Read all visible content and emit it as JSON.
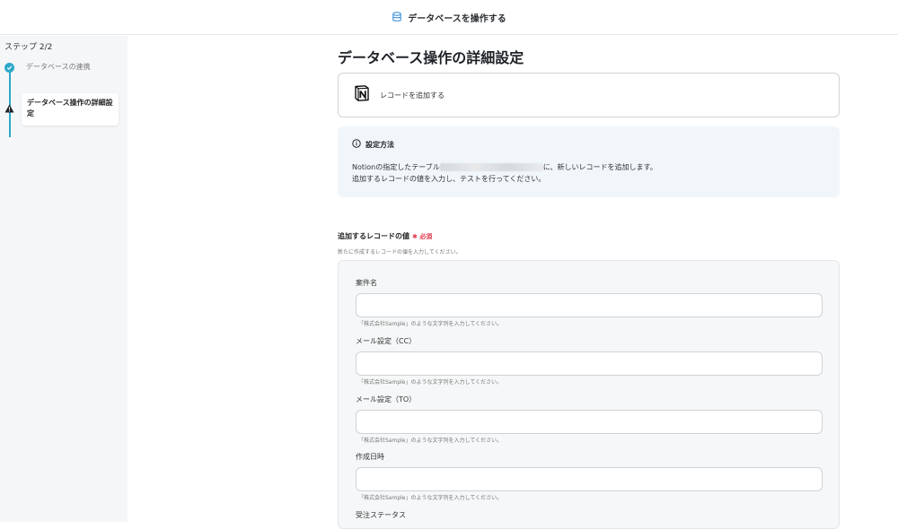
{
  "header": {
    "title": "データベースを操作する",
    "icon": "database-icon"
  },
  "sidebar": {
    "step_counter": "ステップ 2/2",
    "steps": [
      {
        "label": "データベースの連携",
        "status": "completed"
      },
      {
        "label": "データベース操作の詳細設定",
        "status": "current"
      }
    ]
  },
  "main": {
    "title": "データベース操作の詳細設定",
    "app_card": {
      "icon": "notion-logo-icon",
      "label": "レコードを追加する"
    },
    "info": {
      "heading": "設定方法",
      "line1_prefix": "Notionの指定したテーブル",
      "line1_suffix": "に、新しいレコードを追加します。",
      "line2": "追加するレコードの値を入力し、テストを行ってください。"
    },
    "record_section": {
      "heading": "追加するレコードの値",
      "required": "必須",
      "description": "新たに作成するレコードの値を入力してください。",
      "fields": [
        {
          "label": "案件名",
          "value": "",
          "hint": "「株式会社Sample」のような文字列を入力してください。"
        },
        {
          "label": "メール設定（CC）",
          "value": "",
          "hint": "「株式会社Sample」のような文字列を入力してください。"
        },
        {
          "label": "メール設定（TO）",
          "value": "",
          "hint": "「株式会社Sample」のような文字列を入力してください。"
        },
        {
          "label": "作成日時",
          "value": "",
          "hint": "「株式会社Sample」のような文字列を入力してください。"
        },
        {
          "label": "受注ステータス",
          "value": "",
          "hint": ""
        }
      ]
    }
  },
  "colors": {
    "accent": "#2ca9c9",
    "required": "#e0394b",
    "info_bg": "#f1f6fa"
  }
}
